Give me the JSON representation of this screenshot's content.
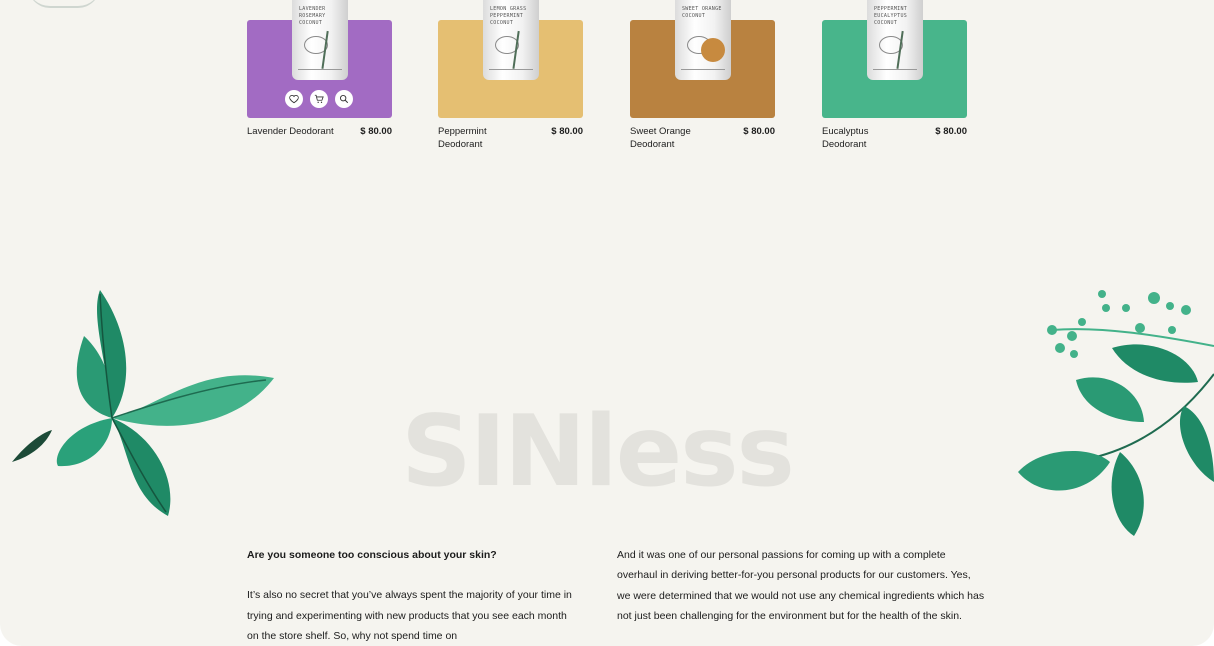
{
  "products": [
    {
      "name": "Lavender Deodorant",
      "price": "$ 80.00",
      "bg_color": "#a26bc3",
      "bottle_label": "LAVENDER\nROSEMARY\nCOCONUT"
    },
    {
      "name": "Peppermint Deodorant",
      "price": "$ 80.00",
      "bg_color": "#e5bf72",
      "bottle_label": "LEMON GRASS\nPEPPERMINT\nCOCONUT"
    },
    {
      "name": "Sweet Orange Deodorant",
      "price": "$ 80.00",
      "bg_color": "#b98240",
      "bottle_label": "SWEET ORANGE\nCOCONUT"
    },
    {
      "name": "Eucalyptus Deodorant",
      "price": "$ 80.00",
      "bg_color": "#48b58b",
      "bottle_label": "PEPPERMINT\nEUCALYPTUS\nCOCONUT"
    }
  ],
  "product_actions": [
    "heart-icon",
    "cart-icon",
    "search-icon"
  ],
  "brand": {
    "name": "SINless",
    "color": "#e3e2dd"
  },
  "intro": {
    "question": "Are you someone too conscious about your skin?",
    "left_text": "It’s also no secret that you’ve always spent the majority of your time in trying and experimenting with new products that you see each month on the store shelf. So, why not spend time on",
    "right_text": "And it was one of our personal passions for coming up with a complete overhaul in deriving better-for-you personal products for our customers. Yes, we were determined that we would not use any chemical ingredients which has not just been challenging for the environment but for the health of the skin."
  },
  "colors": {
    "page_bg": "#f5f4ef",
    "leaf_dark": "#1f8a66",
    "leaf_light": "#43b28a",
    "text": "#1c1c1c"
  }
}
